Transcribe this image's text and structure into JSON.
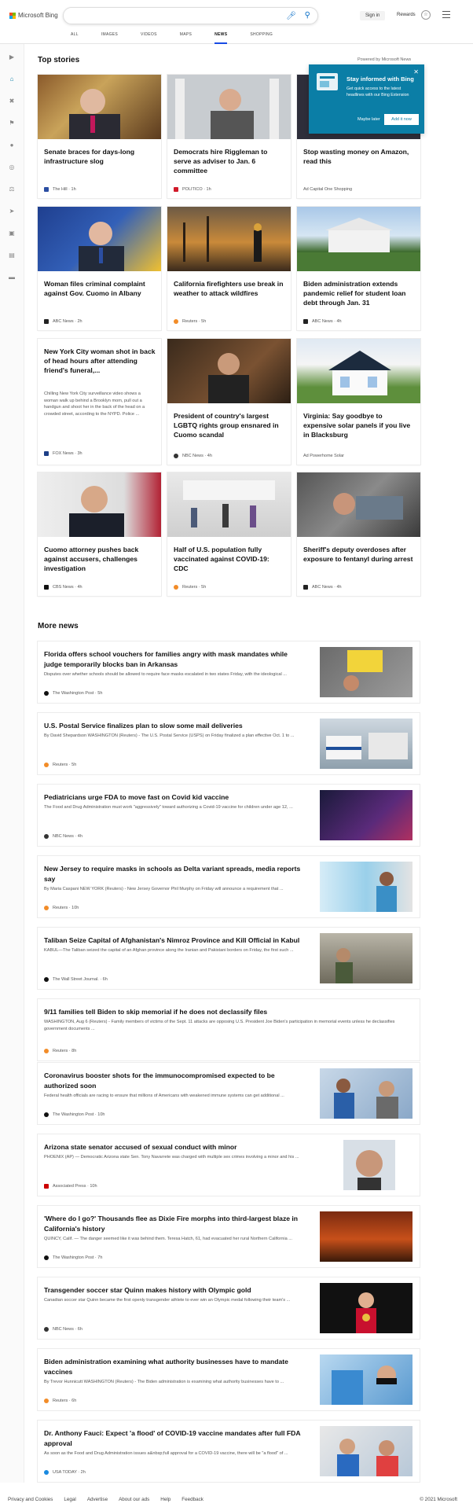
{
  "header": {
    "brand": "Microsoft Bing",
    "search_value": "",
    "signin": "Sign in",
    "rewards": "Rewards",
    "nav": [
      "ALL",
      "IMAGES",
      "VIDEOS",
      "MAPS",
      "NEWS",
      "SHOPPING"
    ],
    "active_nav": "NEWS"
  },
  "top_stories": {
    "heading": "Top stories",
    "powered": "Powered by Microsoft News",
    "cards": [
      {
        "title": "Senate braces for days-long infrastructure slog",
        "source": "The Hill · 1h",
        "desc": ""
      },
      {
        "title": "Democrats hire Riggleman to serve as adviser to Jan. 6 committee",
        "source": "POLITICO · 1h",
        "desc": ""
      },
      {
        "title": "Stop wasting money on Amazon, read this",
        "source": "Ad  Capital One Shopping",
        "desc": ""
      },
      {
        "title": "Woman files criminal complaint against Gov. Cuomo in Albany",
        "source": "ABC News · 2h",
        "desc": ""
      },
      {
        "title": "California firefighters use break in weather to attack wildfires",
        "source": "Reuters · 5h",
        "desc": ""
      },
      {
        "title": "Biden administration extends pandemic relief for student loan debt through Jan. 31",
        "source": "ABC News · 4h",
        "desc": ""
      },
      {
        "title": "New York City woman shot in back of head hours after attending friend's funeral,...",
        "source": "FOX News · 3h",
        "desc": "Chilling New York City surveillance video shows a woman walk up behind a Brooklyn mom, pull out a handgun and shoot her in the back of the head on a crowded street, according to the NYPD. Police ..."
      },
      {
        "title": "President of country's largest LGBTQ rights group ensnared in Cuomo scandal",
        "source": "NBC News · 4h",
        "desc": ""
      },
      {
        "title": "Virginia: Say goodbye to expensive solar panels if you live in Blacksburg",
        "source": "Ad  Powerhome Solar",
        "desc": ""
      },
      {
        "title": "Cuomo attorney pushes back against accusers, challenges investigation",
        "source": "CBS News · 4h",
        "desc": ""
      },
      {
        "title": "Half of U.S. population fully vaccinated against COVID-19: CDC",
        "source": "Reuters · 5h",
        "desc": ""
      },
      {
        "title": "Sheriff's deputy overdoses after exposure to fentanyl during arrest",
        "source": "ABC News · 4h",
        "desc": ""
      }
    ]
  },
  "popup": {
    "title": "Stay informed with Bing",
    "desc": "Get quick access to the latest headlines with our Bing Extension",
    "later": "Maybe later",
    "add": "Add it now"
  },
  "more_news": {
    "heading": "More news",
    "items": [
      {
        "title": "Florida offers school vouchers for families angry with mask mandates while judge temporarily blocks ban in Arkansas",
        "desc": "Disputes over whether schools should be allowed to require face masks escalated in two states Friday, with the ideological ...",
        "source": "The Washington Post · 5h"
      },
      {
        "title": "U.S. Postal Service finalizes plan to slow some mail deliveries",
        "desc": "By David Shepardson WASHINGTON (Reuters) - The U.S. Postal Service (USPS) on Friday finalized a plan effective Oct. 1 to ...",
        "source": "Reuters · 5h"
      },
      {
        "title": "Pediatricians urge FDA to move fast on Covid kid vaccine",
        "desc": "The Food and Drug Administration must work \"aggressively\" toward authorizing a Covid-19 vaccine for children under age 12, ...",
        "source": "NBC News · 4h"
      },
      {
        "title": "New Jersey to require masks in schools as Delta variant spreads, media reports say",
        "desc": "By Maria Caspani NEW YORK (Reuters) - New Jersey Governor Phil Murphy on Friday will announce a requirement that ...",
        "source": "Reuters · 10h"
      },
      {
        "title": "Taliban Seize Capital of Afghanistan's Nimroz Province and Kill Official in Kabul",
        "desc": "KABUL—The Taliban seized the capital of an Afghan province along the Iranian and Pakistani borders on Friday, the first such ...",
        "source": "The Wall Street Journal. · 6h"
      },
      {
        "title": "9/11 families tell Biden to skip memorial if he does not declassify files",
        "desc": "WASHINGTON, Aug 6 (Reuters) - Family members of victims of the Sept. 11 attacks are opposing U.S. President Joe Biden's participation in memorial events unless he declassifies government documents ...",
        "source": "Reuters · 8h"
      },
      {
        "title": "Coronavirus booster shots for the immunocompromised expected to be authorized soon",
        "desc": "Federal health officials are racing to ensure that millions of Americans with weakened immune systems can get additional ...",
        "source": "The Washington Post · 10h"
      },
      {
        "title": "Arizona state senator accused of sexual conduct with minor",
        "desc": "PHOENIX (AP) — Democratic Arizona state Sen. Tony Navarrete was charged with multiple sex crimes involving a minor and his ...",
        "source": "Associated Press · 10h"
      },
      {
        "title": "'Where do I go?' Thousands flee as Dixie Fire morphs into third-largest blaze in California's history",
        "desc": "QUINCY, Calif. — The danger seemed like it was behind them. Teresa Hatch, 61, had evacuated her rural Northern California ...",
        "source": "The Washington Post · 7h"
      },
      {
        "title": "Transgender soccer star Quinn makes history with Olympic gold",
        "desc": "Canadian soccer star Quinn became the first openly transgender athlete to ever win an Olympic medal following their team's ...",
        "source": "NBC News · 6h"
      },
      {
        "title": "Biden administration examining what authority businesses have to mandate vaccines",
        "desc": "By Trevor Hunnicutt WASHINGTON (Reuters) - The Biden administration is examining what authority businesses have to ...",
        "source": "Reuters · 6h"
      },
      {
        "title": "Dr. Anthony Fauci: Expect 'a flood' of COVID-19 vaccine mandates after full FDA approval",
        "desc": "As soon as the Food and Drug Administration issues a&nbsp;full approval for a COVID-19 vaccine, there will be \"a flood\" of ...",
        "source": "USA TODAY · 2h"
      }
    ]
  },
  "footer": {
    "links": [
      "Privacy and Cookies",
      "Legal",
      "Advertise",
      "About our ads",
      "Help",
      "Feedback"
    ],
    "copyright": "© 2021 Microsoft"
  },
  "colors": {
    "accent": "#0b7ea6",
    "link_blue": "#174ae4"
  }
}
